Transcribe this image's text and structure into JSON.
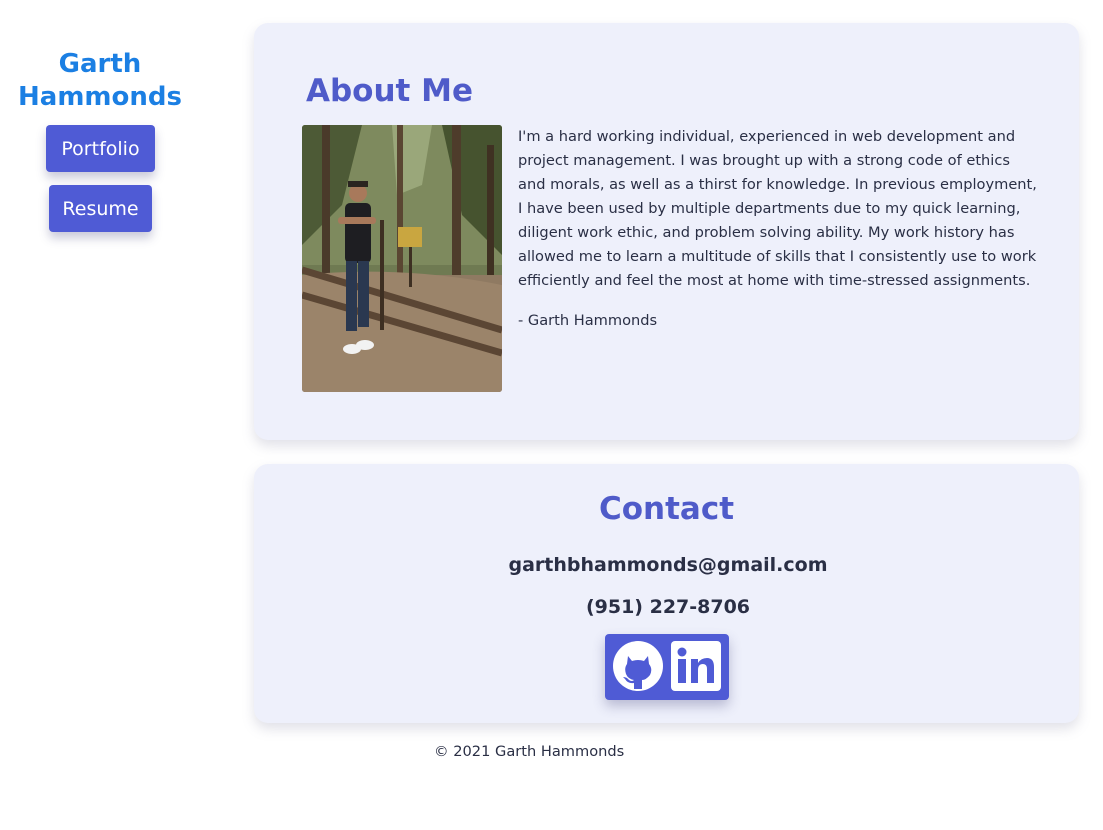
{
  "sidebar": {
    "name": "Garth Hammonds",
    "buttons": [
      {
        "label": "Portfolio"
      },
      {
        "label": "Resume"
      }
    ]
  },
  "about": {
    "title": "About Me",
    "photo_alt": "Photo of Garth Hammonds standing by a wooden fence in a forest",
    "text": "I'm a hard working individual, experienced in web development and project management. I was brought up with a strong code of ethics and morals, as well as a thirst for knowledge. In previous employment, I have been used by multiple departments due to my quick learning, diligent work ethic, and problem solving ability. My work history has allowed me to learn a multitude of skills that I consistently use to work efficiently and feel the most at home with time-stressed assignments.",
    "signature": "- Garth Hammonds"
  },
  "contact": {
    "title": "Contact",
    "email": "garthbhammonds@gmail.com",
    "phone": "(951) 227-8706",
    "social": [
      {
        "icon": "github-icon"
      },
      {
        "icon": "linkedin-icon"
      }
    ]
  },
  "footer": {
    "copyright": "© 2021 Garth Hammonds"
  },
  "colors": {
    "accent": "#4f5bd5",
    "name": "#1b7fe3",
    "heading": "#4f5bc9",
    "card_bg": "#eef0fb"
  }
}
